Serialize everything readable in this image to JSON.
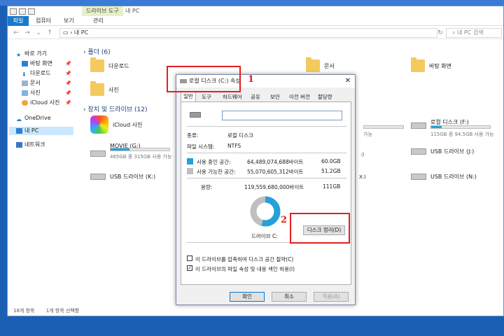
{
  "window": {
    "title": "내 PC",
    "context_tab": "드라이브 도구"
  },
  "ribbon": {
    "tabs": [
      "파일",
      "컴퓨터",
      "보기",
      "관리"
    ]
  },
  "address": {
    "path": "내 PC",
    "search_placeholder": "내 PC 검색"
  },
  "nav": {
    "items": [
      {
        "label": "바로 가기"
      },
      {
        "label": "바탕 화면"
      },
      {
        "label": "다운로드"
      },
      {
        "label": "문서"
      },
      {
        "label": "사진"
      },
      {
        "label": "iCloud 사진"
      },
      {
        "label": "OneDrive"
      },
      {
        "label": "내 PC"
      },
      {
        "label": "네트워크"
      }
    ]
  },
  "folders": {
    "header": "폴더 (6)",
    "items": [
      {
        "label": "다운로드"
      },
      {
        "label": "문서"
      },
      {
        "label": "바탕 화면"
      },
      {
        "label": "사진"
      }
    ]
  },
  "drives": {
    "header": "장치 및 드라이브 (12)",
    "icloud": {
      "label": "iCloud 사진"
    },
    "local_f": {
      "label": "로컬 디스크 (F:)",
      "detail": "115GB 중 94.5GB 사용 가능",
      "used_fraction": 0.18
    },
    "movie": {
      "label": "MOVIE (G:)",
      "detail": "465GB 중 315GB 사용 가능",
      "used_fraction": 0.32
    },
    "usb_j": {
      "label": "USB 드라이브 (J:)"
    },
    "usb_k": {
      "label": "USB 드라이브 (K:)"
    },
    "usb_n": {
      "label": "USB 드라이브 (N:)"
    },
    "partial_1": {
      "detail": "가능"
    },
    "partial_2": {
      "label": ":)"
    },
    "partial_3": {
      "label": "X:)"
    }
  },
  "status": {
    "count": "18개 항목",
    "selected": "1개 항목 선택함"
  },
  "dialog": {
    "title": "로컬 디스크 (C:) 속성",
    "tabs": [
      "일반",
      "도구",
      "하드웨어",
      "공유",
      "보안",
      "이전 버전",
      "할당량"
    ],
    "type_label": "종류:",
    "type_value": "로컬 디스크",
    "fs_label": "파일 시스템:",
    "fs_value": "NTFS",
    "used_label": "사용 중인 공간:",
    "used_bytes": "64,489,074,688바이트",
    "used_gb": "60.0GB",
    "free_label": "사용 가능한 공간:",
    "free_bytes": "55,070,605,312바이트",
    "free_gb": "51.2GB",
    "cap_label": "용량:",
    "cap_bytes": "119,559,680,000바이트",
    "cap_gb": "111GB",
    "drive_label": "드라이브 C:",
    "cleanup_button": "디스크 정리(D)",
    "compress_label": "이 드라이브를 압축하여 디스크 공간 절약(C)",
    "index_label": "이 드라이브의 파일 속성 및 내용 색인 허용(I)",
    "compress_checked": false,
    "index_checked": true,
    "ok": "확인",
    "cancel": "취소",
    "apply": "적용(A)",
    "used_fraction": 0.54,
    "used_color": "#26a0da",
    "free_color": "#bfbfbf"
  },
  "annotations": {
    "one": "1",
    "two": "2"
  }
}
